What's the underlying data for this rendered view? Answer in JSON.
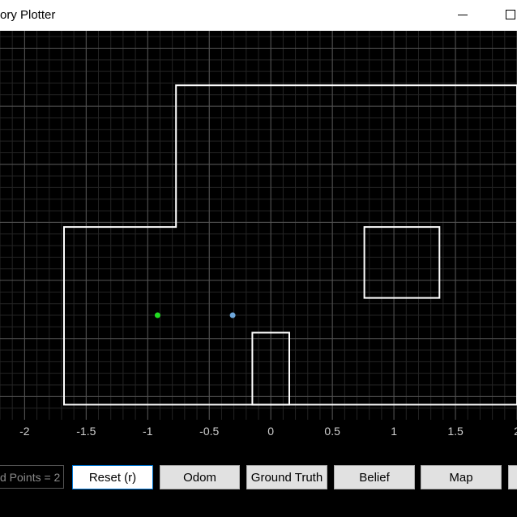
{
  "window": {
    "title": "ory Plotter"
  },
  "controls": {
    "points_label": "d Points = 2",
    "buttons": {
      "reset": "Reset (r)",
      "odom": "Odom",
      "ground_truth": "Ground Truth",
      "belief": "Belief",
      "map": "Map"
    }
  },
  "chart_data": {
    "type": "scatter",
    "x_ticks": [
      "-2",
      "-1.5",
      "-1",
      "-0.5",
      "0",
      "0.5",
      "1",
      "1.5",
      "2"
    ],
    "xlim": [
      -2.2,
      2.0
    ],
    "ylim": [
      -1.2,
      2.15
    ],
    "grid": true,
    "background": "#000000",
    "map_walls": [
      {
        "name": "outer-boundary",
        "points": [
          [
            -1.68,
            -1.07
          ],
          [
            2.0,
            -1.07
          ],
          [
            2.0,
            1.68
          ],
          [
            -0.77,
            1.68
          ],
          [
            -0.77,
            0.46
          ],
          [
            -1.68,
            0.46
          ]
        ]
      },
      {
        "name": "box-obstacle",
        "points": [
          [
            0.76,
            -0.15
          ],
          [
            1.37,
            -0.15
          ],
          [
            1.37,
            0.46
          ],
          [
            0.76,
            0.46
          ]
        ]
      },
      {
        "name": "bottom-obstacle",
        "points": [
          [
            -0.15,
            -1.07
          ],
          [
            0.15,
            -1.07
          ],
          [
            0.15,
            -0.45
          ],
          [
            -0.15,
            -0.45
          ]
        ]
      }
    ],
    "points": [
      {
        "name": "green-point",
        "x": -0.92,
        "y": -0.3,
        "color": "#22dd22"
      },
      {
        "name": "blue-point",
        "x": -0.31,
        "y": -0.3,
        "color": "#6fa8dc"
      }
    ],
    "colors": {
      "wall": "#ffffff",
      "grid_major": "#555555",
      "grid_minor": "#242424"
    }
  }
}
